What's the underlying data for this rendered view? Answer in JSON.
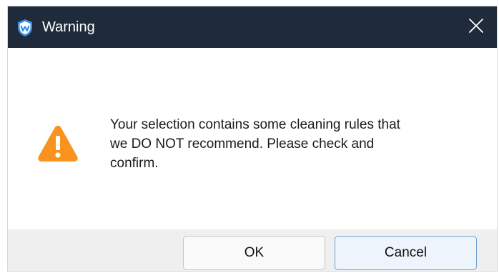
{
  "window": {
    "title": "Warning",
    "app_icon": "shield-logo-icon",
    "close_icon": "close-icon"
  },
  "dialog": {
    "icon": "warning-triangle-icon",
    "message": "Your selection contains some cleaning rules that we DO NOT recommend. Please check and confirm."
  },
  "buttons": {
    "ok_label": "OK",
    "cancel_label": "Cancel"
  },
  "colors": {
    "titlebar": "#1f2a3b",
    "warning": "#f7931e",
    "logo_blue": "#3a8de0",
    "cancel_border": "#6d9fd6"
  }
}
